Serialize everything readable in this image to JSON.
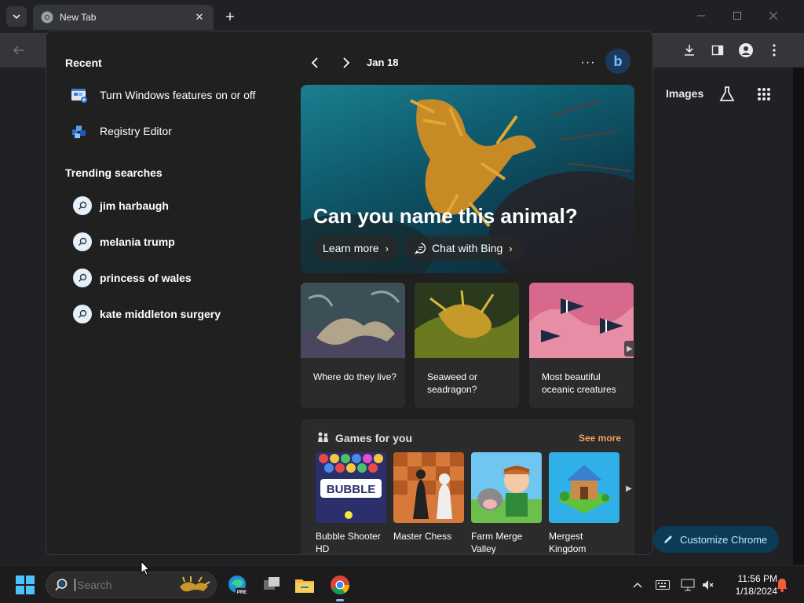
{
  "browser": {
    "tab_title": "New Tab",
    "close_symbol": "✕",
    "new_tab_symbol": "+"
  },
  "page_behind": {
    "images_label": "Images",
    "customize_label": "Customize Chrome"
  },
  "flyout": {
    "recent_heading": "Recent",
    "recent_items": [
      {
        "label": "Turn Windows features on or off",
        "icon": "windows-features-icon"
      },
      {
        "label": "Registry Editor",
        "icon": "registry-editor-icon"
      }
    ],
    "trending_heading": "Trending searches",
    "trending_items": [
      {
        "label": "jim harbaugh"
      },
      {
        "label": "melania trump"
      },
      {
        "label": "princess of wales"
      },
      {
        "label": "kate middleton surgery"
      }
    ],
    "date": "Jan 18",
    "more_symbol": "···",
    "bing_letter": "b",
    "hero": {
      "title": "Can you name this animal?",
      "learn_more": "Learn more",
      "chat_with_bing": "Chat with Bing",
      "chevron": "›"
    },
    "cards": [
      {
        "caption": "Where do they live?"
      },
      {
        "caption": "Seaweed or seadragon?"
      },
      {
        "caption": "Most beautiful oceanic creatures"
      }
    ],
    "games": {
      "title": "Games for you",
      "see_more": "See more",
      "items": [
        {
          "name": "Bubble Shooter HD"
        },
        {
          "name": "Master Chess"
        },
        {
          "name": "Farm Merge Valley"
        },
        {
          "name": "Mergest Kingdom"
        }
      ]
    }
  },
  "taskbar": {
    "search_placeholder": "Search",
    "time": "11:56 PM",
    "date": "1/18/2024"
  },
  "colors": {
    "see_more": "#f0a35a",
    "customize_bg": "#0b3b57",
    "accent_blue": "#0078d4"
  }
}
